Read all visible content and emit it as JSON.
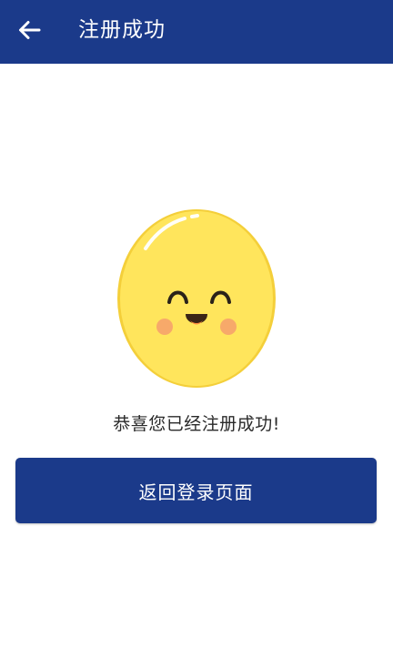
{
  "app_bar": {
    "back_icon": "arrow-left-icon",
    "title": "注册成功"
  },
  "illustration": {
    "icon": "smiling-face-icon"
  },
  "message": "恭喜您已经注册成功!",
  "actions": {
    "return_login_label": "返回登录页面"
  },
  "colors": {
    "primary": "#1B3A8A",
    "face": "#FFE55C",
    "face_shadow": "#F4CF3A",
    "cheek": "#F7A56A",
    "mouth": "#3A2416",
    "tongue": "#FF8A3D"
  }
}
